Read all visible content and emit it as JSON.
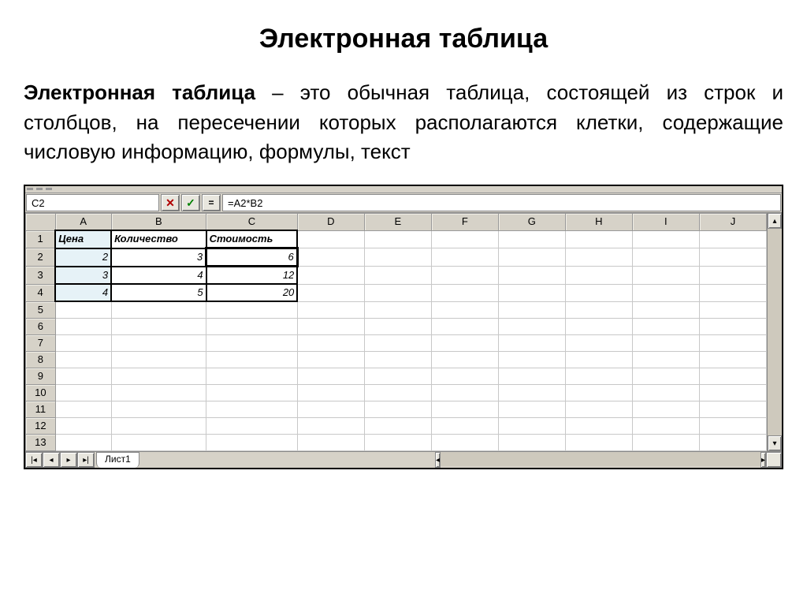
{
  "title": "Электронная таблица",
  "definition_term": "Электронная таблица",
  "definition_rest": " – это обычная таблица, состоящей из строк и столбцов, на пересечении которых располагаются клетки, содержащие числовую информацию, формулы, текст",
  "namebox": "C2",
  "formula": "=A2*B2",
  "icons": {
    "cancel": "✕",
    "accept": "✓",
    "eq": "="
  },
  "columns": [
    "A",
    "B",
    "C",
    "D",
    "E",
    "F",
    "G",
    "H",
    "I",
    "J"
  ],
  "row_numbers": [
    "1",
    "2",
    "3",
    "4",
    "5",
    "6",
    "7",
    "8",
    "9",
    "10",
    "11",
    "12",
    "13"
  ],
  "data_block": {
    "headers": [
      "Цена",
      "Количество",
      "Стоимость"
    ],
    "rows": [
      {
        "a": "2",
        "b": "3",
        "c": "6"
      },
      {
        "a": "3",
        "b": "4",
        "c": "12"
      },
      {
        "a": "4",
        "b": "5",
        "c": "20"
      }
    ]
  },
  "sheet_tab": "Лист1",
  "arrows": {
    "first": "|◂",
    "prev": "◂",
    "next": "▸",
    "last": "▸|",
    "up": "▴",
    "down": "▾",
    "left": "◂",
    "right": "▸"
  }
}
